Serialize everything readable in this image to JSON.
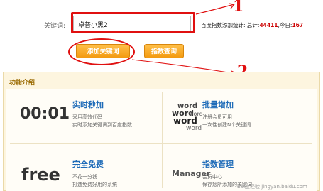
{
  "form": {
    "keyword_label": "关键词:",
    "keyword_value": "卓普小黑2",
    "stats_prefix": "百度指数添加统计: 总计:",
    "stats_total": "44411",
    "stats_today_prefix": ",今日:",
    "stats_today": "167"
  },
  "buttons": {
    "add_keyword": "添加关键词",
    "index_query": "指数查询"
  },
  "panel": {
    "title": "功能介绍",
    "features": [
      {
        "icon_text": "00:01",
        "title": "实时秒加",
        "desc_line1": "采用高效代码",
        "desc_line2": "实时添加关键词到百度指数"
      },
      {
        "icon_text": "word",
        "title": "批量增加",
        "desc_line1": "注册会员可用",
        "desc_line2": "一次性创建N个关键词"
      },
      {
        "icon_text": "free",
        "title": "完全免费",
        "desc_line1": "不花一分钱",
        "desc_line2": "打造免费好用的系统"
      },
      {
        "icon_text": "Manager",
        "title": "指数管理",
        "desc_line1": "会员中心",
        "desc_line2": "保存您所添加的关键词"
      }
    ]
  },
  "annotations": {
    "one": "1",
    "two": "2"
  },
  "watermark": "Bai度经验 jingyan.baidu.com",
  "colors": {
    "annotation": "#e01010",
    "button": "#f5a623",
    "feature_title": "#1e6bb8",
    "stats_number": "#cc0000"
  }
}
